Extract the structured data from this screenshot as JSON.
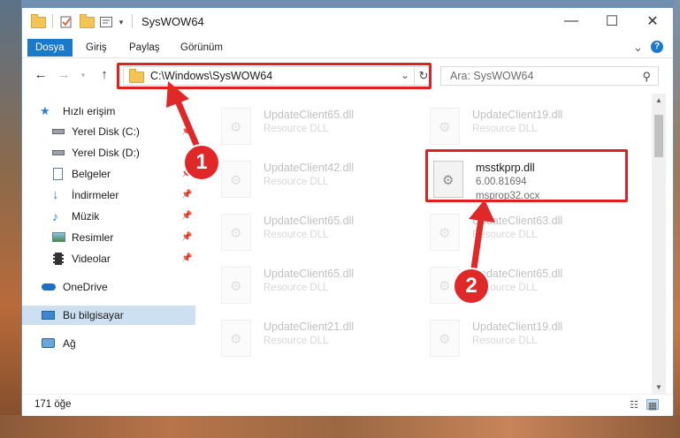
{
  "window": {
    "title": "SysWOW64",
    "minimize_glyph": "—",
    "maximize_glyph": "☐",
    "close_glyph": "✕"
  },
  "ribbon": {
    "tabs": [
      "Dosya",
      "Giriş",
      "Paylaş",
      "Görünüm"
    ],
    "collapse_glyph": "⌄",
    "help_glyph": "?"
  },
  "address": {
    "path": "C:\\Windows\\SysWOW64",
    "search_placeholder": "Ara: SysWOW64"
  },
  "navigation": {
    "quick_access": "Hızlı erişim",
    "items": [
      {
        "label": "Yerel Disk (C:)",
        "icon": "drive-icon",
        "pinned": true
      },
      {
        "label": "Yerel Disk (D:)",
        "icon": "drive-icon",
        "pinned": false
      },
      {
        "label": "Belgeler",
        "icon": "documents-icon",
        "pinned": true
      },
      {
        "label": "İndirmeler",
        "icon": "downloads-icon",
        "pinned": true
      },
      {
        "label": "Müzik",
        "icon": "music-icon",
        "pinned": true
      },
      {
        "label": "Resimler",
        "icon": "pictures-icon",
        "pinned": true
      },
      {
        "label": "Videolar",
        "icon": "videos-icon",
        "pinned": true
      }
    ],
    "onedrive": "OneDrive",
    "this_pc": "Bu bilgisayar",
    "network": "Ağ"
  },
  "files": [
    {
      "name": "UpdateClient65.dll",
      "desc": "Resource DLL",
      "faded": true
    },
    {
      "name": "UpdateClient19.dll",
      "desc": "Resource DLL",
      "faded": true
    },
    {
      "name": "UpdateClient42.dll",
      "desc": "Resource DLL",
      "faded": true
    },
    {
      "name": "msstkprp.dll",
      "version": "6.00.81694",
      "product": "msprop32.ocx",
      "faded": false
    },
    {
      "name": "UpdateClient65.dll",
      "desc": "Resource DLL",
      "faded": true
    },
    {
      "name": "UpdateClient63.dll",
      "desc": "Resource DLL",
      "faded": true
    },
    {
      "name": "UpdateClient65.dll",
      "desc": "Resource DLL",
      "faded": true
    },
    {
      "name": "UpdateClient65.dll",
      "desc": "Resource DLL",
      "faded": true
    },
    {
      "name": "UpdateClient21.dll",
      "desc": "Resource DLL",
      "faded": true
    },
    {
      "name": "UpdateClient19.dll",
      "desc": "Resource DLL",
      "faded": true
    }
  ],
  "status": {
    "item_count": "171 öğe"
  },
  "callouts": [
    "1",
    "2"
  ],
  "colors": {
    "accent": "#1979ca",
    "highlight": "#e02020",
    "selection": "#cce0f2"
  }
}
